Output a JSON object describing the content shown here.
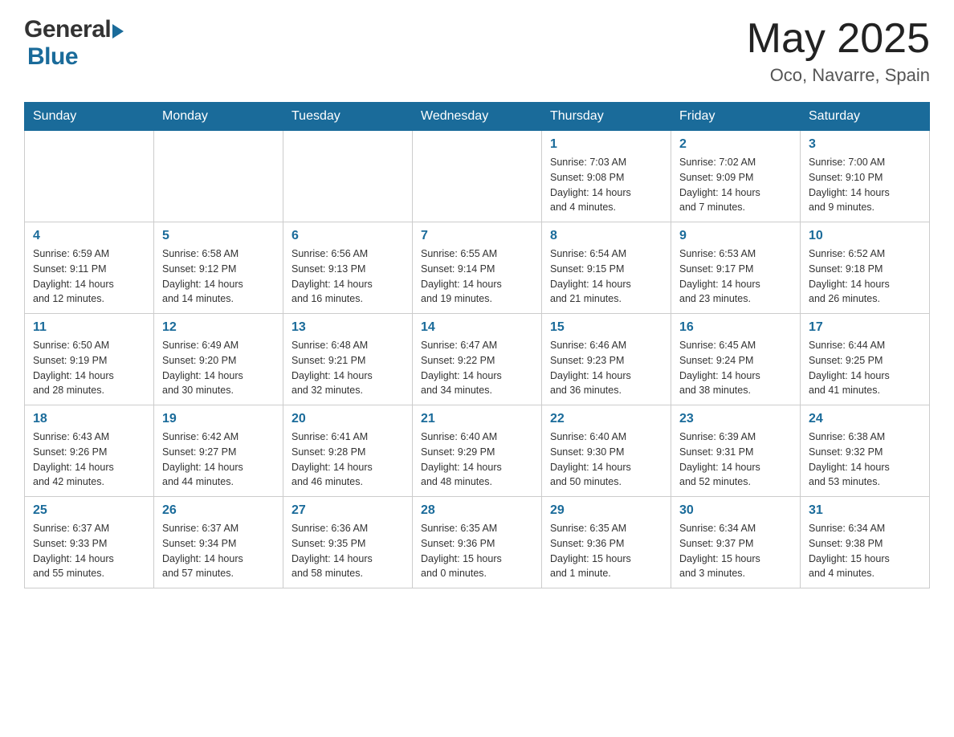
{
  "header": {
    "logo_general": "General",
    "logo_blue": "Blue",
    "month_title": "May 2025",
    "location": "Oco, Navarre, Spain"
  },
  "weekdays": [
    "Sunday",
    "Monday",
    "Tuesday",
    "Wednesday",
    "Thursday",
    "Friday",
    "Saturday"
  ],
  "weeks": [
    [
      {
        "day": "",
        "info": ""
      },
      {
        "day": "",
        "info": ""
      },
      {
        "day": "",
        "info": ""
      },
      {
        "day": "",
        "info": ""
      },
      {
        "day": "1",
        "info": "Sunrise: 7:03 AM\nSunset: 9:08 PM\nDaylight: 14 hours\nand 4 minutes."
      },
      {
        "day": "2",
        "info": "Sunrise: 7:02 AM\nSunset: 9:09 PM\nDaylight: 14 hours\nand 7 minutes."
      },
      {
        "day": "3",
        "info": "Sunrise: 7:00 AM\nSunset: 9:10 PM\nDaylight: 14 hours\nand 9 minutes."
      }
    ],
    [
      {
        "day": "4",
        "info": "Sunrise: 6:59 AM\nSunset: 9:11 PM\nDaylight: 14 hours\nand 12 minutes."
      },
      {
        "day": "5",
        "info": "Sunrise: 6:58 AM\nSunset: 9:12 PM\nDaylight: 14 hours\nand 14 minutes."
      },
      {
        "day": "6",
        "info": "Sunrise: 6:56 AM\nSunset: 9:13 PM\nDaylight: 14 hours\nand 16 minutes."
      },
      {
        "day": "7",
        "info": "Sunrise: 6:55 AM\nSunset: 9:14 PM\nDaylight: 14 hours\nand 19 minutes."
      },
      {
        "day": "8",
        "info": "Sunrise: 6:54 AM\nSunset: 9:15 PM\nDaylight: 14 hours\nand 21 minutes."
      },
      {
        "day": "9",
        "info": "Sunrise: 6:53 AM\nSunset: 9:17 PM\nDaylight: 14 hours\nand 23 minutes."
      },
      {
        "day": "10",
        "info": "Sunrise: 6:52 AM\nSunset: 9:18 PM\nDaylight: 14 hours\nand 26 minutes."
      }
    ],
    [
      {
        "day": "11",
        "info": "Sunrise: 6:50 AM\nSunset: 9:19 PM\nDaylight: 14 hours\nand 28 minutes."
      },
      {
        "day": "12",
        "info": "Sunrise: 6:49 AM\nSunset: 9:20 PM\nDaylight: 14 hours\nand 30 minutes."
      },
      {
        "day": "13",
        "info": "Sunrise: 6:48 AM\nSunset: 9:21 PM\nDaylight: 14 hours\nand 32 minutes."
      },
      {
        "day": "14",
        "info": "Sunrise: 6:47 AM\nSunset: 9:22 PM\nDaylight: 14 hours\nand 34 minutes."
      },
      {
        "day": "15",
        "info": "Sunrise: 6:46 AM\nSunset: 9:23 PM\nDaylight: 14 hours\nand 36 minutes."
      },
      {
        "day": "16",
        "info": "Sunrise: 6:45 AM\nSunset: 9:24 PM\nDaylight: 14 hours\nand 38 minutes."
      },
      {
        "day": "17",
        "info": "Sunrise: 6:44 AM\nSunset: 9:25 PM\nDaylight: 14 hours\nand 41 minutes."
      }
    ],
    [
      {
        "day": "18",
        "info": "Sunrise: 6:43 AM\nSunset: 9:26 PM\nDaylight: 14 hours\nand 42 minutes."
      },
      {
        "day": "19",
        "info": "Sunrise: 6:42 AM\nSunset: 9:27 PM\nDaylight: 14 hours\nand 44 minutes."
      },
      {
        "day": "20",
        "info": "Sunrise: 6:41 AM\nSunset: 9:28 PM\nDaylight: 14 hours\nand 46 minutes."
      },
      {
        "day": "21",
        "info": "Sunrise: 6:40 AM\nSunset: 9:29 PM\nDaylight: 14 hours\nand 48 minutes."
      },
      {
        "day": "22",
        "info": "Sunrise: 6:40 AM\nSunset: 9:30 PM\nDaylight: 14 hours\nand 50 minutes."
      },
      {
        "day": "23",
        "info": "Sunrise: 6:39 AM\nSunset: 9:31 PM\nDaylight: 14 hours\nand 52 minutes."
      },
      {
        "day": "24",
        "info": "Sunrise: 6:38 AM\nSunset: 9:32 PM\nDaylight: 14 hours\nand 53 minutes."
      }
    ],
    [
      {
        "day": "25",
        "info": "Sunrise: 6:37 AM\nSunset: 9:33 PM\nDaylight: 14 hours\nand 55 minutes."
      },
      {
        "day": "26",
        "info": "Sunrise: 6:37 AM\nSunset: 9:34 PM\nDaylight: 14 hours\nand 57 minutes."
      },
      {
        "day": "27",
        "info": "Sunrise: 6:36 AM\nSunset: 9:35 PM\nDaylight: 14 hours\nand 58 minutes."
      },
      {
        "day": "28",
        "info": "Sunrise: 6:35 AM\nSunset: 9:36 PM\nDaylight: 15 hours\nand 0 minutes."
      },
      {
        "day": "29",
        "info": "Sunrise: 6:35 AM\nSunset: 9:36 PM\nDaylight: 15 hours\nand 1 minute."
      },
      {
        "day": "30",
        "info": "Sunrise: 6:34 AM\nSunset: 9:37 PM\nDaylight: 15 hours\nand 3 minutes."
      },
      {
        "day": "31",
        "info": "Sunrise: 6:34 AM\nSunset: 9:38 PM\nDaylight: 15 hours\nand 4 minutes."
      }
    ]
  ]
}
